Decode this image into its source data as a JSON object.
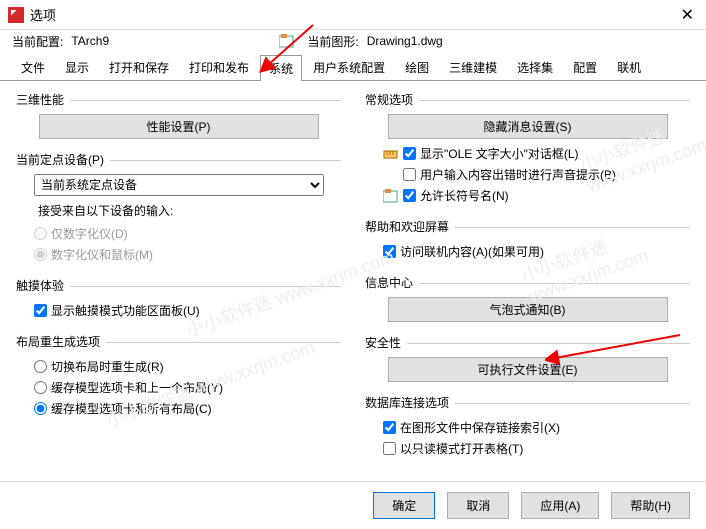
{
  "window": {
    "title": "选项"
  },
  "config": {
    "current_label": "当前配置:",
    "current_value": "TArch9",
    "drawing_label": "当前图形:",
    "drawing_value": "Drawing1.dwg"
  },
  "tabs": [
    "文件",
    "显示",
    "打开和保存",
    "打印和发布",
    "系统",
    "用户系统配置",
    "绘图",
    "三维建模",
    "选择集",
    "配置",
    "联机"
  ],
  "active_tab": 4,
  "left": {
    "perf": {
      "title": "三维性能",
      "button": "性能设置(P)"
    },
    "pointing": {
      "title": "当前定点设备(P)",
      "select": "当前系统定点设备",
      "accept_label": "接受来自以下设备的输入:",
      "opt1": "仅数字化仪(D)",
      "opt2": "数字化仪和鼠标(M)"
    },
    "touch": {
      "title": "触摸体验",
      "check": "显示触摸模式功能区面板(U)"
    },
    "layout": {
      "title": "布局重生成选项",
      "opt1": "切换布局时重生成(R)",
      "opt2": "缓存模型选项卡和上一个布局(Y)",
      "opt3": "缓存模型选项卡和所有布局(C)"
    }
  },
  "right": {
    "general": {
      "title": "常规选项",
      "button": "隐藏消息设置(S)",
      "check1": "显示\"OLE 文字大小\"对话框(L)",
      "check2": "用户输入内容出错时进行声音提示(B)",
      "check3": "允许长符号名(N)"
    },
    "help": {
      "title": "帮助和欢迎屏幕",
      "check": "访问联机内容(A)(如果可用)"
    },
    "info": {
      "title": "信息中心",
      "button": "气泡式通知(B)"
    },
    "security": {
      "title": "安全性",
      "button": "可执行文件设置(E)"
    },
    "db": {
      "title": "数据库连接选项",
      "check1": "在图形文件中保存链接索引(X)",
      "check2": "以只读模式打开表格(T)"
    }
  },
  "footer": {
    "ok": "确定",
    "cancel": "取消",
    "apply": "应用(A)",
    "help": "帮助(H)"
  },
  "watermark": "小小软件迷   www.xxrjm.com"
}
